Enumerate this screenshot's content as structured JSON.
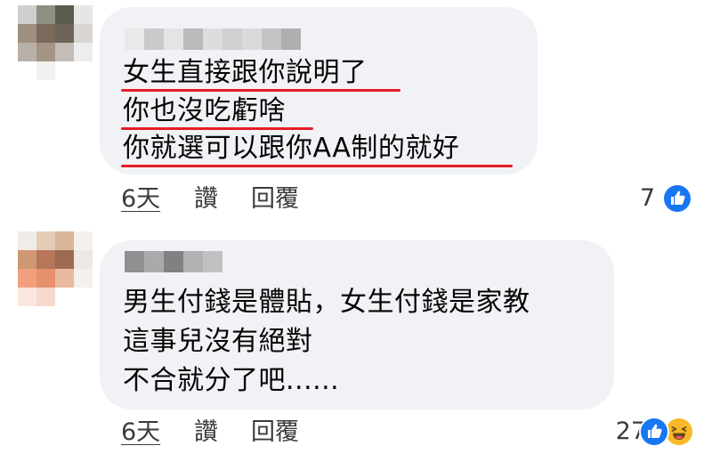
{
  "comments": [
    {
      "lines": [
        "女生直接跟你說明了",
        "你也沒吃虧啥",
        "你就選可以跟你AA制的就好"
      ],
      "actions": {
        "time": "6天",
        "like": "讚",
        "reply": "回覆"
      },
      "reaction_count": "7",
      "reaction_types": [
        "like-icon"
      ],
      "underline_color": "#e41e26",
      "avatar_colors": [
        "#cfcfd1",
        "#8f8f83",
        "#5b5a4e",
        "#e6e6e6",
        "#9e8f80",
        "#7b6a5a",
        "#6e6458",
        "#d8d5d2",
        "#b9b1a9",
        "#a39486",
        "#c4bcb6",
        "#ededed",
        "#ffffff",
        "#f3f1ef",
        "#ffffff",
        "#ffffff"
      ],
      "author_colors": [
        "#e9e9ea",
        "#c9cacc",
        "#e3e4e5",
        "#b9babc",
        "#dcdddf",
        "#cfd0d2",
        "#d9dadc",
        "#c3c4c6",
        "#aeafb1"
      ]
    },
    {
      "lines": [
        "男生付錢是體貼，女生付錢是家教",
        "這事兒沒有絕對",
        "不合就分了吧......"
      ],
      "actions": {
        "time": "6天",
        "like": "讚",
        "reply": "回覆"
      },
      "reaction_count": "27",
      "reaction_types": [
        "like-icon",
        "haha-icon"
      ],
      "avatar_colors": [
        "#f1ece7",
        "#e4ccb7",
        "#d9b69a",
        "#f4f0ec",
        "#cf9873",
        "#b77658",
        "#9c6b52",
        "#efe7e2",
        "#f19f7d",
        "#e6906c",
        "#e8b8a0",
        "#f6efea",
        "#f9e7df",
        "#f6d9cd",
        "#ffffff",
        "#ffffff"
      ],
      "author_colors": [
        "#8e9091",
        "#a8aaac",
        "#7f8183",
        "#b0b2b4",
        "#bfc1c3"
      ]
    }
  ],
  "colors": {
    "bubble": "#f0f2f5",
    "text": "#050505",
    "meta": "#3a3b3c",
    "like_blue": "#1877f2",
    "haha_yellow": "#f7b928"
  }
}
